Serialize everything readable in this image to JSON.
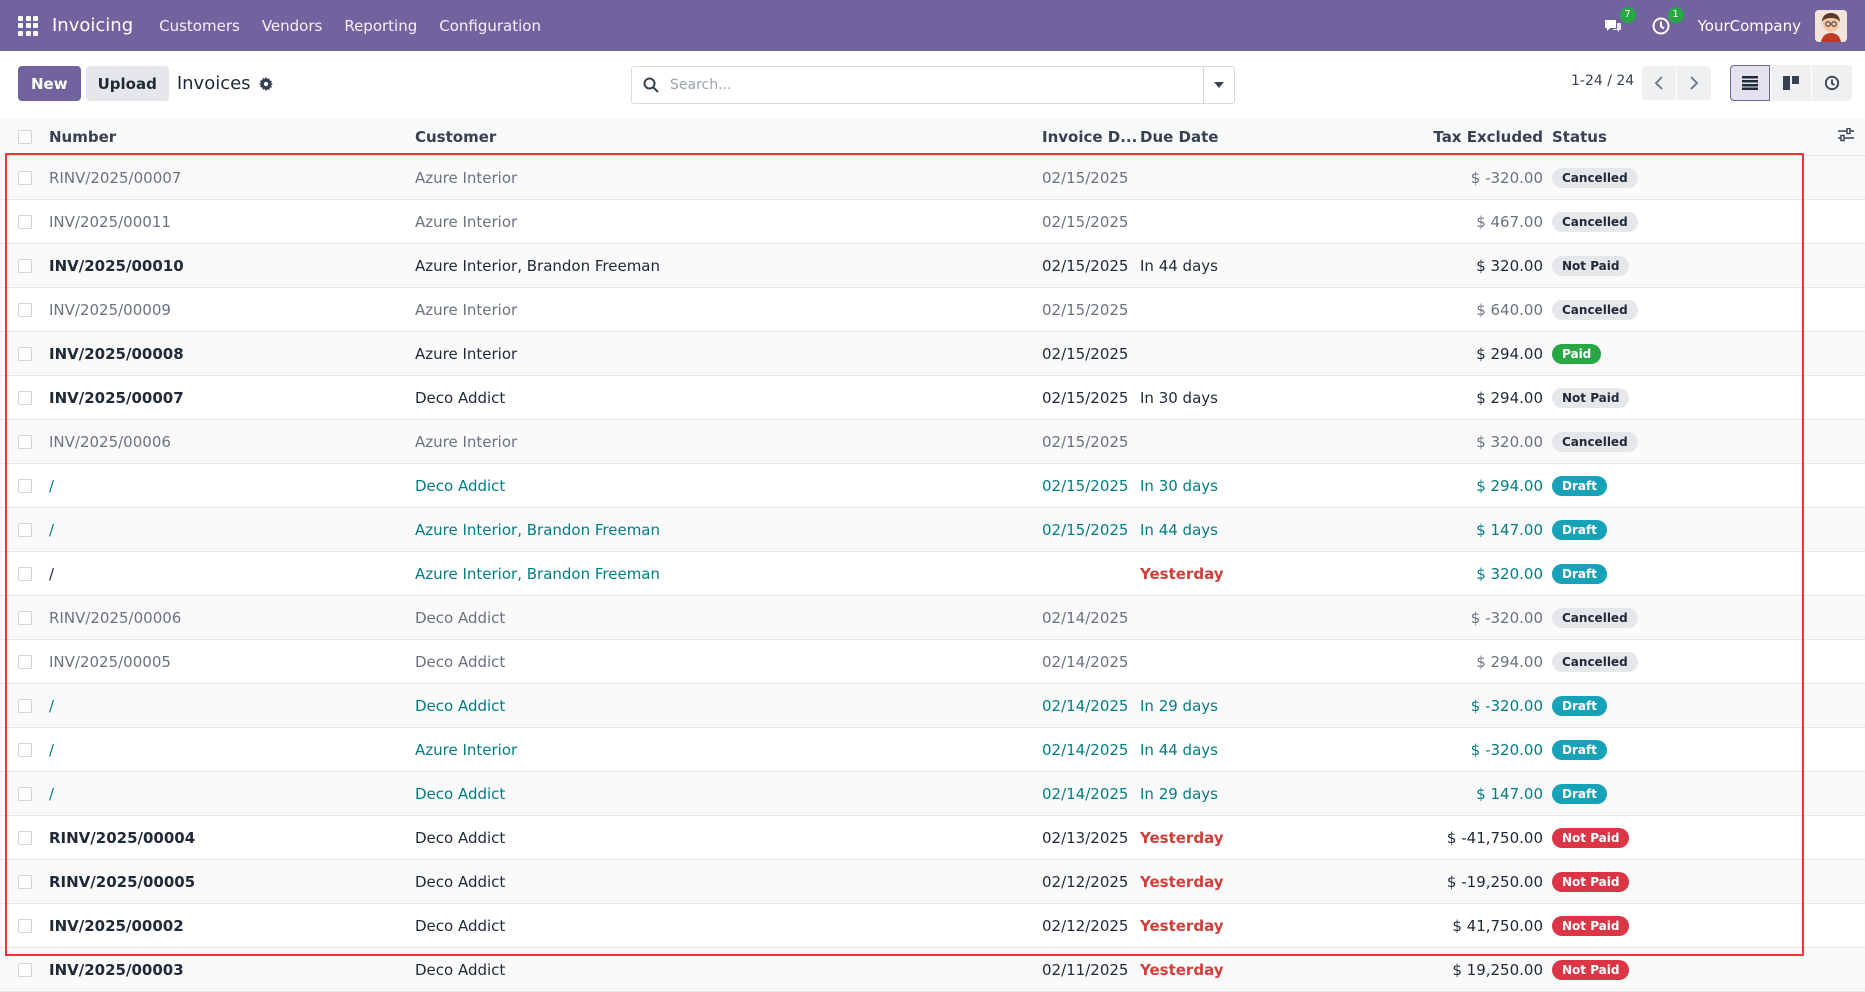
{
  "navbar": {
    "brand": "Invoicing",
    "menu": [
      "Customers",
      "Vendors",
      "Reporting",
      "Configuration"
    ],
    "messages_count": "7",
    "activities_count": "1",
    "company": "YourCompany"
  },
  "control": {
    "new_label": "New",
    "upload_label": "Upload",
    "title": "Invoices",
    "search_placeholder": "Search...",
    "pager": "1-24 / 24"
  },
  "table": {
    "headers": {
      "number": "Number",
      "customer": "Customer",
      "invoice_date": "Invoice D...",
      "due_date": "Due Date",
      "tax_excluded": "Tax Excluded",
      "status": "Status"
    },
    "rows": [
      {
        "number": "RINV/2025/00007",
        "customer": "Azure Interior",
        "invoice_date": "02/15/2025",
        "due_date": "",
        "tax": "$ -320.00",
        "status": "Cancelled",
        "kind": "cancelled"
      },
      {
        "number": "INV/2025/00011",
        "customer": "Azure Interior",
        "invoice_date": "02/15/2025",
        "due_date": "",
        "tax": "$ 467.00",
        "status": "Cancelled",
        "kind": "cancelled"
      },
      {
        "number": "INV/2025/00010",
        "customer": "Azure Interior, Brandon Freeman",
        "invoice_date": "02/15/2025",
        "due_date": "In 44 days",
        "tax": "$ 320.00",
        "status": "Not Paid",
        "kind": "notpaid"
      },
      {
        "number": "INV/2025/00009",
        "customer": "Azure Interior",
        "invoice_date": "02/15/2025",
        "due_date": "",
        "tax": "$ 640.00",
        "status": "Cancelled",
        "kind": "cancelled"
      },
      {
        "number": "INV/2025/00008",
        "customer": "Azure Interior",
        "invoice_date": "02/15/2025",
        "due_date": "",
        "tax": "$ 294.00",
        "status": "Paid",
        "kind": "paid"
      },
      {
        "number": "INV/2025/00007",
        "customer": "Deco Addict",
        "invoice_date": "02/15/2025",
        "due_date": "In 30 days",
        "tax": "$ 294.00",
        "status": "Not Paid",
        "kind": "notpaid"
      },
      {
        "number": "INV/2025/00006",
        "customer": "Azure Interior",
        "invoice_date": "02/15/2025",
        "due_date": "",
        "tax": "$ 320.00",
        "status": "Cancelled",
        "kind": "cancelled"
      },
      {
        "number": "/",
        "customer": "Deco Addict",
        "invoice_date": "02/15/2025",
        "due_date": "In 30 days",
        "tax": "$ 294.00",
        "status": "Draft",
        "kind": "draft"
      },
      {
        "number": "/",
        "customer": "Azure Interior, Brandon Freeman",
        "invoice_date": "02/15/2025",
        "due_date": "In 44 days",
        "tax": "$ 147.00",
        "status": "Draft",
        "kind": "draft"
      },
      {
        "number": "/",
        "customer": "Azure Interior, Brandon Freeman",
        "invoice_date": "",
        "due_date": "Yesterday",
        "tax": "$ 320.00",
        "status": "Draft",
        "kind": "draft-overdue"
      },
      {
        "number": "RINV/2025/00006",
        "customer": "Deco Addict",
        "invoice_date": "02/14/2025",
        "due_date": "",
        "tax": "$ -320.00",
        "status": "Cancelled",
        "kind": "cancelled"
      },
      {
        "number": "INV/2025/00005",
        "customer": "Deco Addict",
        "invoice_date": "02/14/2025",
        "due_date": "",
        "tax": "$ 294.00",
        "status": "Cancelled",
        "kind": "cancelled"
      },
      {
        "number": "/",
        "customer": "Deco Addict",
        "invoice_date": "02/14/2025",
        "due_date": "In 29 days",
        "tax": "$ -320.00",
        "status": "Draft",
        "kind": "draft"
      },
      {
        "number": "/",
        "customer": "Azure Interior",
        "invoice_date": "02/14/2025",
        "due_date": "In 44 days",
        "tax": "$ -320.00",
        "status": "Draft",
        "kind": "draft"
      },
      {
        "number": "/",
        "customer": "Deco Addict",
        "invoice_date": "02/14/2025",
        "due_date": "In 29 days",
        "tax": "$ 147.00",
        "status": "Draft",
        "kind": "draft"
      },
      {
        "number": "RINV/2025/00004",
        "customer": "Deco Addict",
        "invoice_date": "02/13/2025",
        "due_date": "Yesterday",
        "tax": "$ -41,750.00",
        "status": "Not Paid",
        "kind": "overdue"
      },
      {
        "number": "RINV/2025/00005",
        "customer": "Deco Addict",
        "invoice_date": "02/12/2025",
        "due_date": "Yesterday",
        "tax": "$ -19,250.00",
        "status": "Not Paid",
        "kind": "overdue"
      },
      {
        "number": "INV/2025/00002",
        "customer": "Deco Addict",
        "invoice_date": "02/12/2025",
        "due_date": "Yesterday",
        "tax": "$ 41,750.00",
        "status": "Not Paid",
        "kind": "overdue"
      },
      {
        "number": "INV/2025/00003",
        "customer": "Deco Addict",
        "invoice_date": "02/11/2025",
        "due_date": "Yesterday",
        "tax": "$ 19,250.00",
        "status": "Not Paid",
        "kind": "overdue"
      }
    ]
  },
  "colors": {
    "brand": "#71639e",
    "draft": "#017e84",
    "overdue": "#d23f3a",
    "paid": "#28a745",
    "highlight": "#e53935"
  }
}
